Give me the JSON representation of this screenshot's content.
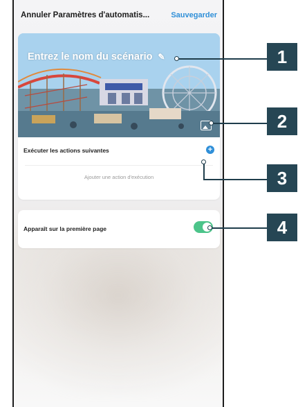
{
  "topbar": {
    "cancel_label": "Annuler",
    "title": "Paramètres d'automatis...",
    "save_label": "Sauvegarder"
  },
  "cover": {
    "title": "Entrez le nom du scénario",
    "edit_icon": "pencil-icon",
    "image_icon": "image-icon"
  },
  "actions": {
    "title": "Exécuter les actions suivantes",
    "add_button": "+",
    "add_placeholder": "Ajouter une action d'exécution"
  },
  "homepage": {
    "label": "Apparaît sur la première page",
    "toggle_on": true,
    "accent": "#4cc48a"
  },
  "callouts": [
    "1",
    "2",
    "3",
    "4"
  ],
  "colors": {
    "link": "#2f8fd8",
    "badge": "#264654"
  }
}
